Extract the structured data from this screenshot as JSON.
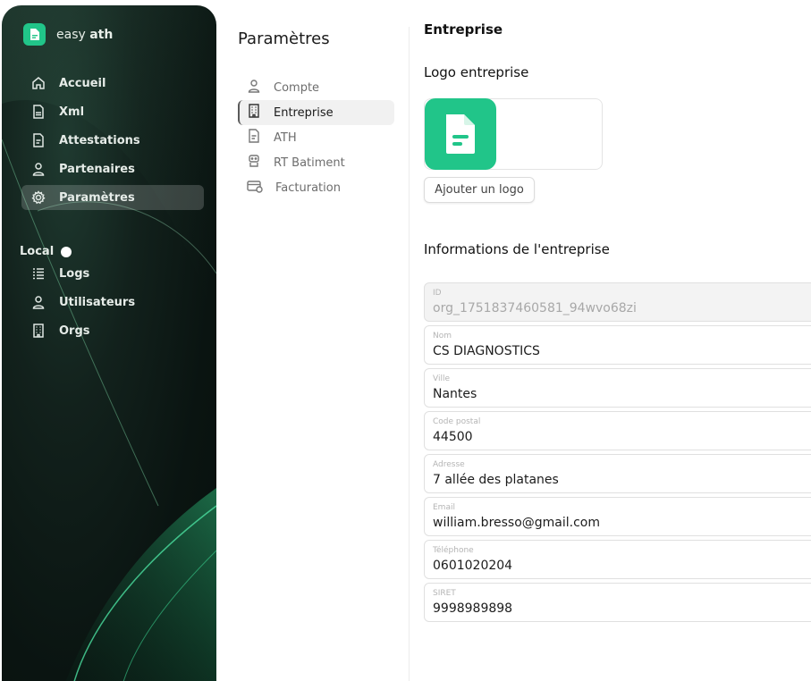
{
  "sidebar": {
    "brand": {
      "name_light": "easy",
      "name_bold": "ath"
    },
    "items": [
      {
        "label": "Accueil",
        "icon": "home-icon"
      },
      {
        "label": "Xml",
        "icon": "xml-file-icon"
      },
      {
        "label": "Attestations",
        "icon": "document-icon"
      },
      {
        "label": "Partenaires",
        "icon": "user-icon"
      },
      {
        "label": "Paramètres",
        "icon": "gear-icon",
        "active": true
      }
    ],
    "local_label": "Local",
    "admin_items": [
      {
        "label": "Logs",
        "icon": "list-icon"
      },
      {
        "label": "Utilisateurs",
        "icon": "user-icon"
      },
      {
        "label": "Orgs",
        "icon": "building-icon"
      }
    ]
  },
  "settings": {
    "title": "Paramètres",
    "menu": [
      {
        "label": "Compte",
        "icon": "user-icon"
      },
      {
        "label": "Entreprise",
        "icon": "building-icon",
        "active": true
      },
      {
        "label": "ATH",
        "icon": "document-icon"
      },
      {
        "label": "RT Batiment",
        "icon": "robot-icon"
      },
      {
        "label": "Facturation",
        "icon": "billing-card-icon"
      }
    ]
  },
  "main": {
    "title": "Entreprise",
    "logo_heading": "Logo entreprise",
    "add_logo_label": "Ajouter un logo",
    "info_heading": "Informations de l'entreprise",
    "fields": [
      {
        "label": "ID",
        "value": "org_1751837460581_94wvo68zi",
        "disabled": true
      },
      {
        "label": "Nom",
        "value": "CS DIAGNOSTICS"
      },
      {
        "label": "Ville",
        "value": "Nantes"
      },
      {
        "label": "Code postal",
        "value": "44500"
      },
      {
        "label": "Adresse",
        "value": "7 allée des platanes"
      },
      {
        "label": "Email",
        "value": "william.bresso@gmail.com"
      },
      {
        "label": "Téléphone",
        "value": "0601020204"
      },
      {
        "label": "SIRET",
        "value": "9998989898"
      }
    ]
  },
  "colors": {
    "accent": "#21c589",
    "sidebar_bg": "#0a1411"
  }
}
